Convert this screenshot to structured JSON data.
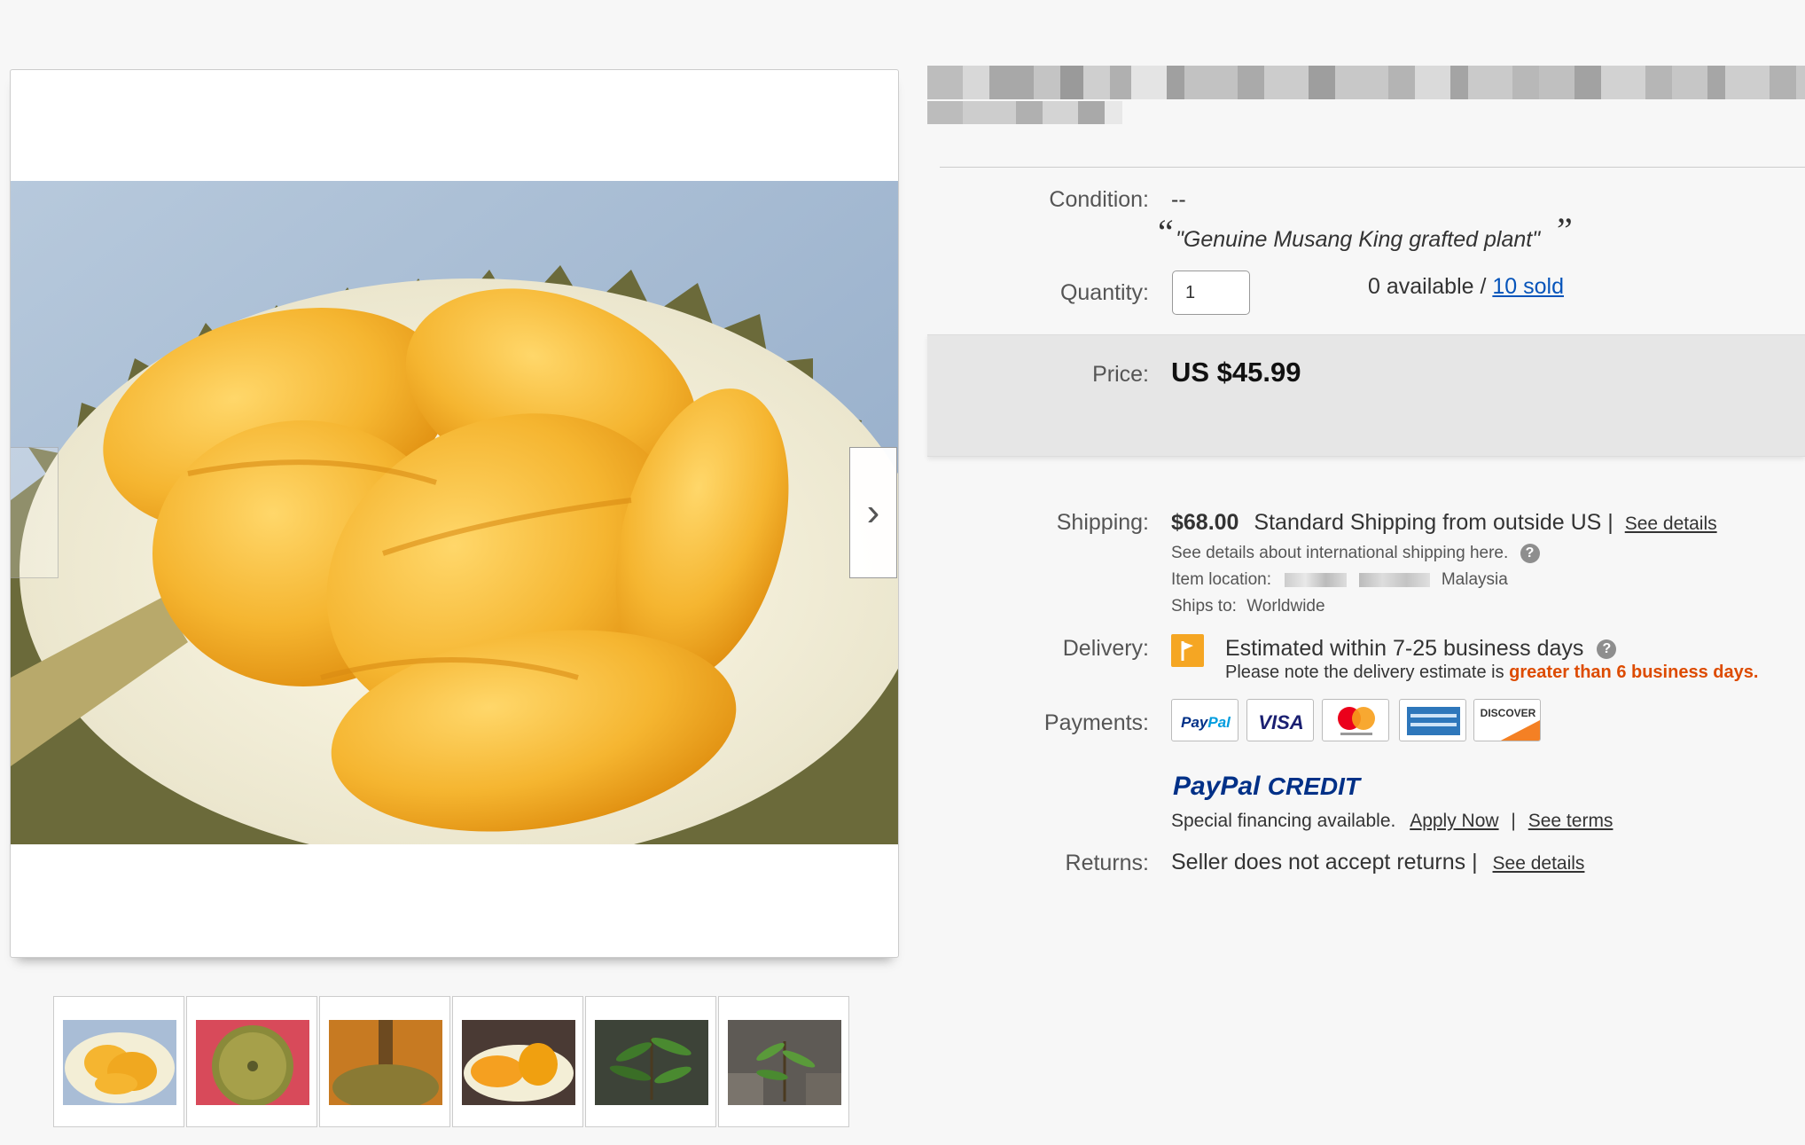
{
  "gallery": {
    "prev_arrow": "",
    "next_arrow": "›",
    "thumbnails": [
      "durian-flesh",
      "durian-shell",
      "durian-stem",
      "durian-halved",
      "durian-plant",
      "durian-plant-pot"
    ]
  },
  "item": {
    "condition_label": "Condition:",
    "condition_value": "--",
    "condition_quote": "\"Genuine Musang King grafted plant\"",
    "quantity_label": "Quantity:",
    "quantity_value": "1",
    "available_text": "0 available / ",
    "sold_link": "10 sold",
    "price_label": "Price:",
    "price_value": "US $45.99"
  },
  "shipping": {
    "label": "Shipping:",
    "cost": "$68.00",
    "method": "Standard Shipping from outside US |",
    "see_details": "See details",
    "intl_note": "See details about international shipping here.",
    "location_label": "Item location:",
    "location_country": "Malaysia",
    "ships_to_label": "Ships to:",
    "ships_to_value": "Worldwide"
  },
  "delivery": {
    "label": "Delivery:",
    "estimate": "Estimated within 7-25 business days",
    "note_prefix": "Please note the delivery estimate is",
    "note_highlight": "greater than 6 business days.",
    "highlight_color": "#dd4b00"
  },
  "payments": {
    "label": "Payments:",
    "methods": [
      "PayPal",
      "VISA",
      "Mastercard",
      "American Express",
      "Discover"
    ],
    "credit_brand_1": "PayPal",
    "credit_brand_2": "CREDIT",
    "financing_text": "Special financing available.",
    "apply_now": "Apply Now",
    "separator": "|",
    "see_terms": "See terms"
  },
  "returns": {
    "label": "Returns:",
    "value": "Seller does not accept returns |",
    "see_details": "See details"
  },
  "colors": {
    "link_blue": "#0654ba",
    "price_bg": "#e6e6e6",
    "delivery_flag": "#f5a623"
  }
}
